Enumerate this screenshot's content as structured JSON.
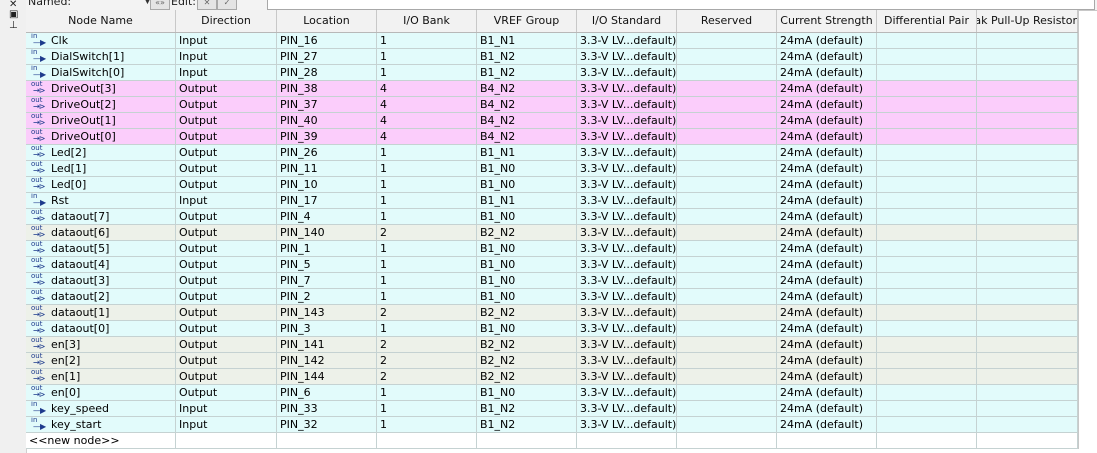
{
  "toolbar": {
    "named_label": "Named:",
    "edit_label": "Edit:",
    "named_value": "",
    "edit_value": ""
  },
  "side_icons": [
    "close-icon",
    "restore-icon",
    "pin-icon"
  ],
  "table": {
    "columns": [
      "Node Name",
      "Direction",
      "Location",
      "I/O Bank",
      "VREF Group",
      "I/O Standard",
      "Reserved",
      "Current Strength",
      "Differential Pair",
      "Weak Pull-Up Resistor"
    ],
    "rows": [
      {
        "pin": "in",
        "name": "Clk",
        "direction": "Input",
        "location": "PIN_16",
        "bank": "1",
        "vref": "B1_N1",
        "standard": "3.3-V LV...default)",
        "reserved": "",
        "strength": "24mA (default)",
        "diff": "",
        "pullup": "",
        "tint": "cyan"
      },
      {
        "pin": "in",
        "name": "DialSwitch[1]",
        "direction": "Input",
        "location": "PIN_27",
        "bank": "1",
        "vref": "B1_N2",
        "standard": "3.3-V LV...default)",
        "reserved": "",
        "strength": "24mA (default)",
        "diff": "",
        "pullup": "",
        "tint": "cyan"
      },
      {
        "pin": "in",
        "name": "DialSwitch[0]",
        "direction": "Input",
        "location": "PIN_28",
        "bank": "1",
        "vref": "B1_N2",
        "standard": "3.3-V LV...default)",
        "reserved": "",
        "strength": "24mA (default)",
        "diff": "",
        "pullup": "",
        "tint": "cyan"
      },
      {
        "pin": "out",
        "name": "DriveOut[3]",
        "direction": "Output",
        "location": "PIN_38",
        "bank": "4",
        "vref": "B4_N2",
        "standard": "3.3-V LV...default)",
        "reserved": "",
        "strength": "24mA (default)",
        "diff": "",
        "pullup": "",
        "tint": "pink"
      },
      {
        "pin": "out",
        "name": "DriveOut[2]",
        "direction": "Output",
        "location": "PIN_37",
        "bank": "4",
        "vref": "B4_N2",
        "standard": "3.3-V LV...default)",
        "reserved": "",
        "strength": "24mA (default)",
        "diff": "",
        "pullup": "",
        "tint": "pink"
      },
      {
        "pin": "out",
        "name": "DriveOut[1]",
        "direction": "Output",
        "location": "PIN_40",
        "bank": "4",
        "vref": "B4_N2",
        "standard": "3.3-V LV...default)",
        "reserved": "",
        "strength": "24mA (default)",
        "diff": "",
        "pullup": "",
        "tint": "pink"
      },
      {
        "pin": "out",
        "name": "DriveOut[0]",
        "direction": "Output",
        "location": "PIN_39",
        "bank": "4",
        "vref": "B4_N2",
        "standard": "3.3-V LV...default)",
        "reserved": "",
        "strength": "24mA (default)",
        "diff": "",
        "pullup": "",
        "tint": "pink"
      },
      {
        "pin": "out",
        "name": "Led[2]",
        "direction": "Output",
        "location": "PIN_26",
        "bank": "1",
        "vref": "B1_N1",
        "standard": "3.3-V LV...default)",
        "reserved": "",
        "strength": "24mA (default)",
        "diff": "",
        "pullup": "",
        "tint": "cyan"
      },
      {
        "pin": "out",
        "name": "Led[1]",
        "direction": "Output",
        "location": "PIN_11",
        "bank": "1",
        "vref": "B1_N0",
        "standard": "3.3-V LV...default)",
        "reserved": "",
        "strength": "24mA (default)",
        "diff": "",
        "pullup": "",
        "tint": "cyan"
      },
      {
        "pin": "out",
        "name": "Led[0]",
        "direction": "Output",
        "location": "PIN_10",
        "bank": "1",
        "vref": "B1_N0",
        "standard": "3.3-V LV...default)",
        "reserved": "",
        "strength": "24mA (default)",
        "diff": "",
        "pullup": "",
        "tint": "cyan"
      },
      {
        "pin": "in",
        "name": "Rst",
        "direction": "Input",
        "location": "PIN_17",
        "bank": "1",
        "vref": "B1_N1",
        "standard": "3.3-V LV...default)",
        "reserved": "",
        "strength": "24mA (default)",
        "diff": "",
        "pullup": "",
        "tint": "cyan"
      },
      {
        "pin": "out",
        "name": "dataout[7]",
        "direction": "Output",
        "location": "PIN_4",
        "bank": "1",
        "vref": "B1_N0",
        "standard": "3.3-V LV...default)",
        "reserved": "",
        "strength": "24mA (default)",
        "diff": "",
        "pullup": "",
        "tint": "cyan"
      },
      {
        "pin": "out",
        "name": "dataout[6]",
        "direction": "Output",
        "location": "PIN_140",
        "bank": "2",
        "vref": "B2_N2",
        "standard": "3.3-V LV...default)",
        "reserved": "",
        "strength": "24mA (default)",
        "diff": "",
        "pullup": "",
        "tint": "gray"
      },
      {
        "pin": "out",
        "name": "dataout[5]",
        "direction": "Output",
        "location": "PIN_1",
        "bank": "1",
        "vref": "B1_N0",
        "standard": "3.3-V LV...default)",
        "reserved": "",
        "strength": "24mA (default)",
        "diff": "",
        "pullup": "",
        "tint": "cyan"
      },
      {
        "pin": "out",
        "name": "dataout[4]",
        "direction": "Output",
        "location": "PIN_5",
        "bank": "1",
        "vref": "B1_N0",
        "standard": "3.3-V LV...default)",
        "reserved": "",
        "strength": "24mA (default)",
        "diff": "",
        "pullup": "",
        "tint": "cyan"
      },
      {
        "pin": "out",
        "name": "dataout[3]",
        "direction": "Output",
        "location": "PIN_7",
        "bank": "1",
        "vref": "B1_N0",
        "standard": "3.3-V LV...default)",
        "reserved": "",
        "strength": "24mA (default)",
        "diff": "",
        "pullup": "",
        "tint": "cyan"
      },
      {
        "pin": "out",
        "name": "dataout[2]",
        "direction": "Output",
        "location": "PIN_2",
        "bank": "1",
        "vref": "B1_N0",
        "standard": "3.3-V LV...default)",
        "reserved": "",
        "strength": "24mA (default)",
        "diff": "",
        "pullup": "",
        "tint": "cyan"
      },
      {
        "pin": "out",
        "name": "dataout[1]",
        "direction": "Output",
        "location": "PIN_143",
        "bank": "2",
        "vref": "B2_N2",
        "standard": "3.3-V LV...default)",
        "reserved": "",
        "strength": "24mA (default)",
        "diff": "",
        "pullup": "",
        "tint": "gray"
      },
      {
        "pin": "out",
        "name": "dataout[0]",
        "direction": "Output",
        "location": "PIN_3",
        "bank": "1",
        "vref": "B1_N0",
        "standard": "3.3-V LV...default)",
        "reserved": "",
        "strength": "24mA (default)",
        "diff": "",
        "pullup": "",
        "tint": "cyan"
      },
      {
        "pin": "out",
        "name": "en[3]",
        "direction": "Output",
        "location": "PIN_141",
        "bank": "2",
        "vref": "B2_N2",
        "standard": "3.3-V LV...default)",
        "reserved": "",
        "strength": "24mA (default)",
        "diff": "",
        "pullup": "",
        "tint": "gray"
      },
      {
        "pin": "out",
        "name": "en[2]",
        "direction": "Output",
        "location": "PIN_142",
        "bank": "2",
        "vref": "B2_N2",
        "standard": "3.3-V LV...default)",
        "reserved": "",
        "strength": "24mA (default)",
        "diff": "",
        "pullup": "",
        "tint": "gray"
      },
      {
        "pin": "out",
        "name": "en[1]",
        "direction": "Output",
        "location": "PIN_144",
        "bank": "2",
        "vref": "B2_N2",
        "standard": "3.3-V LV...default)",
        "reserved": "",
        "strength": "24mA (default)",
        "diff": "",
        "pullup": "",
        "tint": "gray"
      },
      {
        "pin": "out",
        "name": "en[0]",
        "direction": "Output",
        "location": "PIN_6",
        "bank": "1",
        "vref": "B1_N0",
        "standard": "3.3-V LV...default)",
        "reserved": "",
        "strength": "24mA (default)",
        "diff": "",
        "pullup": "",
        "tint": "cyan"
      },
      {
        "pin": "in",
        "name": "key_speed",
        "direction": "Input",
        "location": "PIN_33",
        "bank": "1",
        "vref": "B1_N2",
        "standard": "3.3-V LV...default)",
        "reserved": "",
        "strength": "24mA (default)",
        "diff": "",
        "pullup": "",
        "tint": "cyan"
      },
      {
        "pin": "in",
        "name": "key_start",
        "direction": "Input",
        "location": "PIN_32",
        "bank": "1",
        "vref": "B1_N2",
        "standard": "3.3-V LV...default)",
        "reserved": "",
        "strength": "24mA (default)",
        "diff": "",
        "pullup": "",
        "tint": "cyan"
      }
    ],
    "new_node_label": "<<new node>>"
  },
  "colors": {
    "row_cyan": "#e2fbfb",
    "row_pink": "#fbcdfb",
    "row_gray": "#edf1e9",
    "header_bg": "#f2f2f2",
    "pin_icon": "#1d3a8c"
  }
}
